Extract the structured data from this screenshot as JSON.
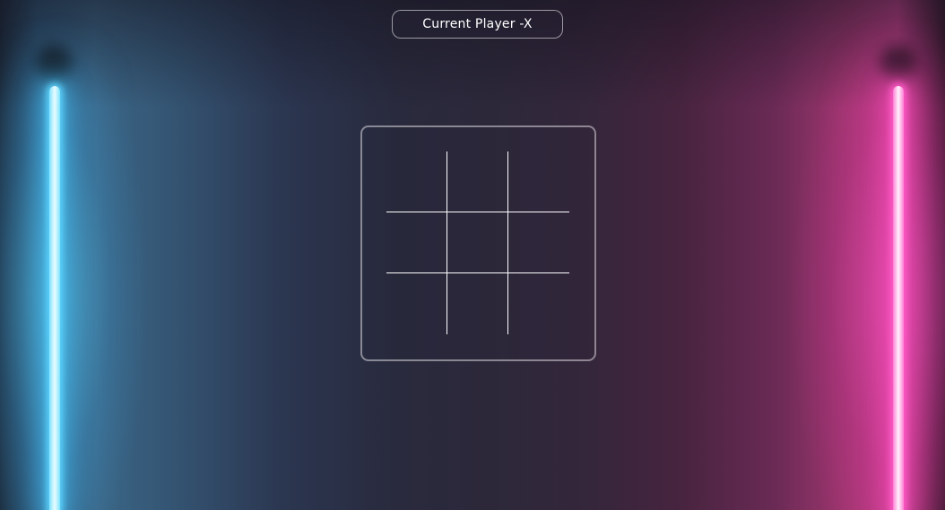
{
  "status": {
    "text": "Current Player -X"
  },
  "board": {
    "cells": [
      "",
      "",
      "",
      "",
      "",
      "",
      "",
      "",
      ""
    ]
  },
  "colors": {
    "neon_left": "#7fe3ff",
    "neon_right": "#ff7fd6",
    "grid_line": "#ffffff"
  }
}
